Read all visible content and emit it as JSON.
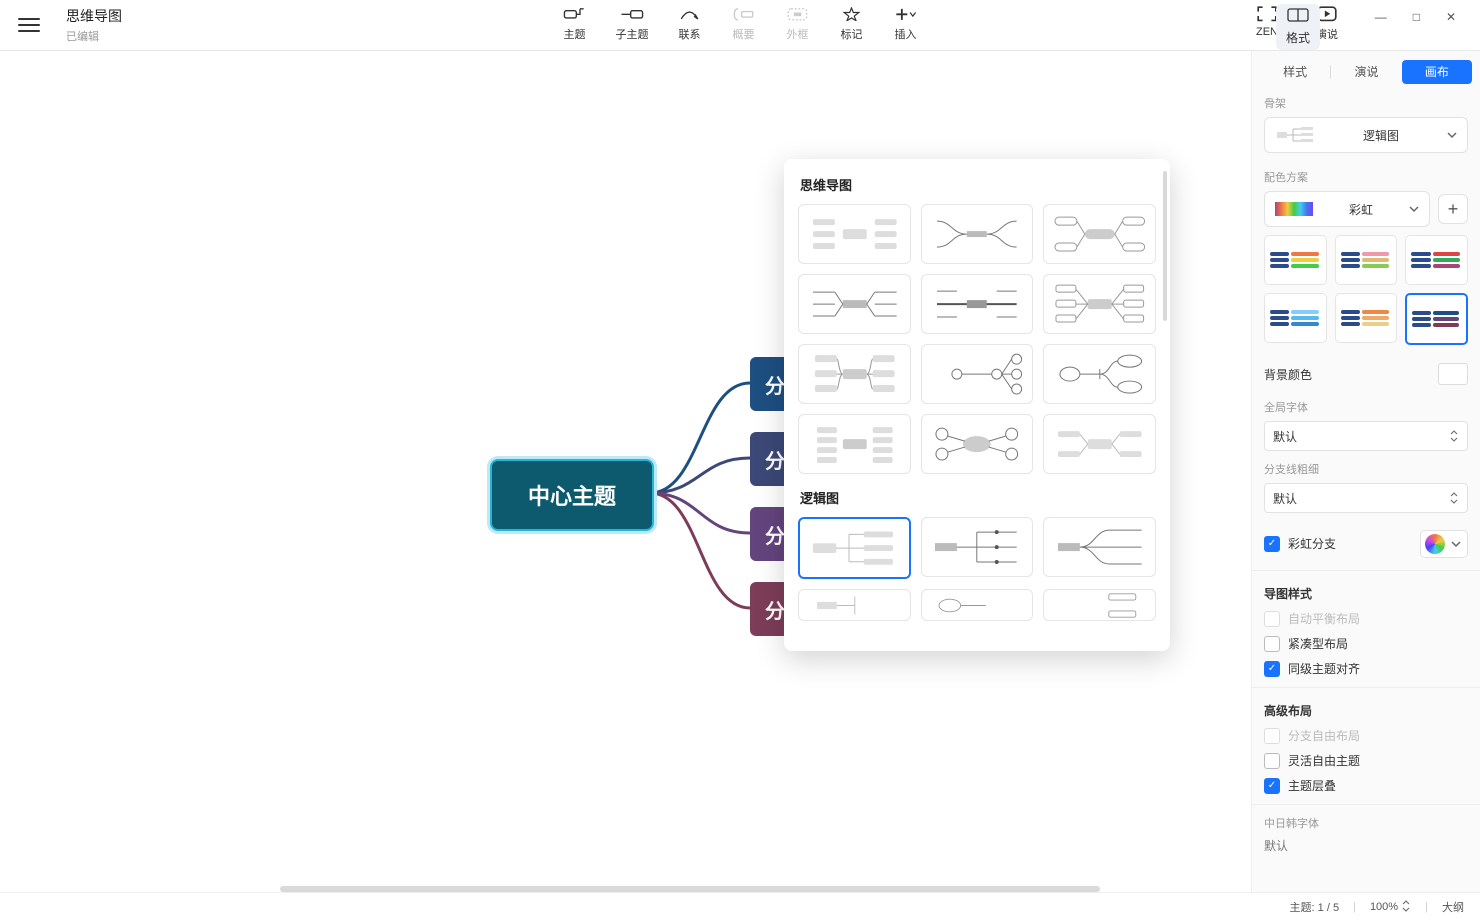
{
  "doc": {
    "title": "思维导图",
    "status": "已编辑"
  },
  "toolbar": {
    "topic": "主题",
    "subtopic": "子主题",
    "relation": "联系",
    "summary": "概要",
    "boundary": "外框",
    "marker": "标记",
    "insert": "插入",
    "zen": "ZEN",
    "present": "演说",
    "format": "格式"
  },
  "canvas": {
    "center": "中心主题",
    "branch_prefix": "分"
  },
  "popup": {
    "section1": "思维导图",
    "section2": "逻辑图"
  },
  "panel": {
    "tab_style": "样式",
    "tab_present": "演说",
    "tab_canvas": "画布",
    "skeleton_label": "骨架",
    "skeleton_value": "逻辑图",
    "scheme_label": "配色方案",
    "scheme_value": "彩虹",
    "bg_label": "背景颜色",
    "font_label": "全局字体",
    "font_value": "默认",
    "linew_label": "分支线粗细",
    "linew_value": "默认",
    "rainbow_branch": "彩虹分支",
    "map_style": "导图样式",
    "auto_balance": "自动平衡布局",
    "compact": "紧凑型布局",
    "align_siblings": "同级主题对齐",
    "adv_layout": "高级布局",
    "free_branch": "分支自由布局",
    "free_topic": "灵活自由主题",
    "overlap": "主题层叠",
    "cjk_font": "中日韩字体",
    "cjk_value": "默认"
  },
  "status": {
    "topic": "主题: 1 / 5",
    "zoom": "100%",
    "outline": "大纲"
  }
}
